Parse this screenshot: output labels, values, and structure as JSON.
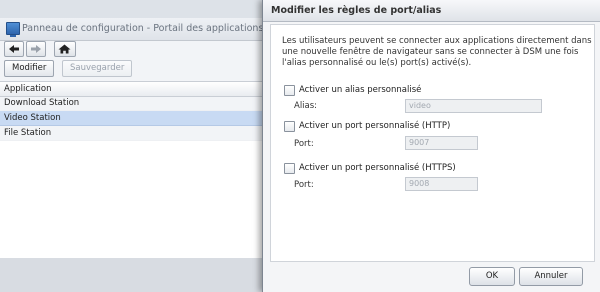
{
  "background_window": {
    "title": "Panneau de configuration - Portail des applications",
    "toolbar": {
      "modify_label": "Modifier",
      "save_label": "Sauvegarder"
    },
    "grid": {
      "column_header": "Application",
      "rows": [
        "Download Station",
        "Video Station",
        "File Station"
      ],
      "selected_row": "Video Station"
    },
    "icons": {
      "back": "arrow-left-icon",
      "forward": "arrow-right-icon",
      "home": "home-icon"
    }
  },
  "dialog": {
    "title": "Modifier les règles de port/alias",
    "description": "Les utilisateurs peuvent se connecter aux applications directement dans une nouvelle fenêtre de navigateur sans se connecter à DSM une fois l'alias personnalisé ou le(s) port(s) activé(s).",
    "alias": {
      "checkbox_label": "Activer un alias personnalisé",
      "field_label": "Alias:",
      "value": "video"
    },
    "http": {
      "checkbox_label": "Activer un port personnalisé (HTTP)",
      "field_label": "Port:",
      "value": "9007"
    },
    "https": {
      "checkbox_label": "Activer un port personnalisé (HTTPS)",
      "field_label": "Port:",
      "value": "9008"
    },
    "buttons": {
      "ok": "OK",
      "cancel": "Annuler"
    }
  },
  "colors": {
    "selected_row": "#c8daf3",
    "dialog_bg": "#f4f5f7"
  }
}
